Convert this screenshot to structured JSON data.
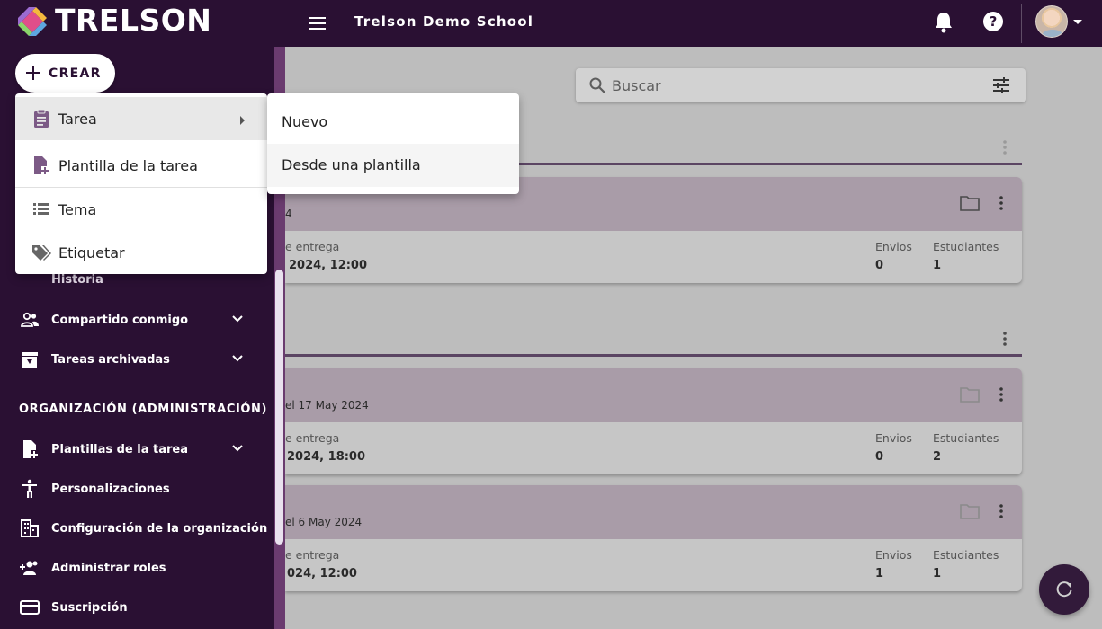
{
  "header": {
    "brand": "TRELSON",
    "school": "Trelson Demo School"
  },
  "create_button": {
    "label": "CREAR"
  },
  "create_menu": {
    "items": [
      {
        "label": "Tarea",
        "icon": "clipboard-icon"
      },
      {
        "label": "Plantilla de la tarea",
        "icon": "file-plus-icon"
      },
      {
        "label": "Tema",
        "icon": "list-icon"
      },
      {
        "label": "Etiquetar",
        "icon": "tags-icon"
      }
    ],
    "submenu": [
      {
        "label": "Nuevo"
      },
      {
        "label": "Desde una plantilla"
      }
    ]
  },
  "sidebar": {
    "history": "Historia",
    "items": [
      {
        "label": "Compartido conmigo",
        "icon": "people-icon"
      },
      {
        "label": "Tareas archivadas",
        "icon": "archive-icon"
      }
    ],
    "section": "ORGANIZACIÓN (ADMINISTRACIÓN)",
    "admin_items": [
      {
        "label": "Plantillas de la tarea",
        "icon": "file-plus-icon"
      },
      {
        "label": "Personalizaciones",
        "icon": "accessibility-icon"
      },
      {
        "label": "Configuración de la organización",
        "icon": "building-icon"
      },
      {
        "label": "Administrar roles",
        "icon": "people-add-icon"
      },
      {
        "label": "Suscripción",
        "icon": "card-icon"
      }
    ]
  },
  "search": {
    "placeholder": "Buscar"
  },
  "cards": [
    {
      "head_sub": "4",
      "due_label": "e entrega",
      "due_value": "2024, 12:00",
      "envios_label": "Envios",
      "envios_value": "0",
      "est_label": "Estudiantes",
      "est_value": "1"
    },
    {
      "head_sub": "el 17 May 2024",
      "due_label": "e entrega",
      "due_value": "2024, 18:00",
      "envios_label": "Envios",
      "envios_value": "0",
      "est_label": "Estudiantes",
      "est_value": "2"
    },
    {
      "head_sub": "el 6 May 2024",
      "due_label": "e entrega",
      "due_value": "024, 12:00",
      "envios_label": "Envios",
      "envios_value": "1",
      "est_label": "Estudiantes",
      "est_value": "1"
    }
  ]
}
